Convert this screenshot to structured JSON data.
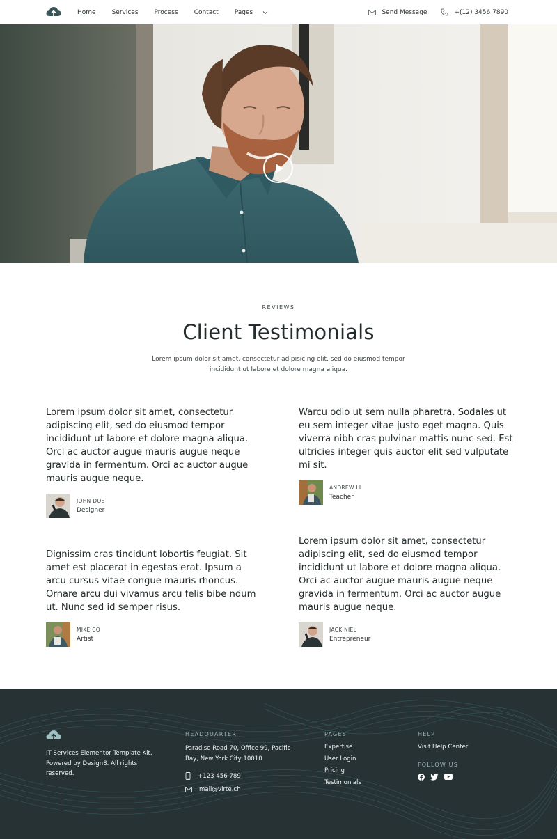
{
  "nav": {
    "menu": [
      {
        "label": "Home"
      },
      {
        "label": "Services"
      },
      {
        "label": "Process"
      },
      {
        "label": "Contact"
      }
    ],
    "pages_label": "Pages",
    "send_message": "Send Message",
    "phone": "+(12) 3456 7890"
  },
  "reviews": {
    "eyebrow": "REVIEWS",
    "title": "Client Testimonials",
    "subtitle": "Lorem ipsum dolor sit amet, consectetur adipisicing elit, sed do eiusmod tempor incididunt ut labore et dolore magna aliqua.",
    "items": [
      {
        "quote": "Lorem ipsum dolor sit amet, consectetur adipiscing elit, sed do eiusmod tempor incididunt ut labore et dolore magna aliqua. Orci ac auctor augue mauris augue neque gravida in fermentum. Orci ac auctor augue mauris augue neque.",
        "name": "JOHN DOE",
        "role": "Designer"
      },
      {
        "quote": "Warcu odio ut sem nulla pharetra. Sodales ut eu sem integer vitae justo eget magna. Quis viverra nibh cras pulvinar mattis nunc sed. Est ultricies integer quis auctor elit sed vulputate mi sit.",
        "name": "ANDREW LI",
        "role": "Teacher"
      },
      {
        "quote": "Dignissim cras tincidunt lobortis feugiat. Sit amet est placerat in egestas erat. Ipsum a arcu cursus vitae congue mauris rhoncus. Ornare arcu dui vivamus arcu felis bibe ndum ut. Nunc sed id semper risus.",
        "name": "MIKE CO",
        "role": "Artist"
      },
      {
        "quote": "Lorem ipsum dolor sit amet, consectetur adipiscing elit, sed do eiusmod tempor incididunt ut labore et dolore magna aliqua. Orci ac auctor augue mauris augue neque gravida in fermentum. Orci ac auctor augue mauris augue neque.",
        "name": "JACK NIEL",
        "role": "Entrepreneur"
      }
    ]
  },
  "footer": {
    "about": "IT Services Elementor Template Kit. Powered by Design8. All rights reserved.",
    "hq_heading": "HEADQUARTER",
    "address": "Paradise Road 70, Office 99, Pacific Bay,  New York City 10010",
    "phone": "+123 456 789",
    "email": "mail@virte.ch",
    "pages_heading": "PAGES",
    "pages": [
      "Expertise",
      "User Login",
      "Pricing",
      "Testimonials"
    ],
    "help_heading": "HELP",
    "help_link": "Visit Help Center",
    "follow_heading": "FOLLOW US",
    "social_icons": [
      "facebook-icon",
      "twitter-icon",
      "youtube-icon"
    ]
  },
  "colors": {
    "footer_bg": "#263234",
    "text_dark": "#232b2c",
    "accent_teal": "#3f6a70"
  }
}
